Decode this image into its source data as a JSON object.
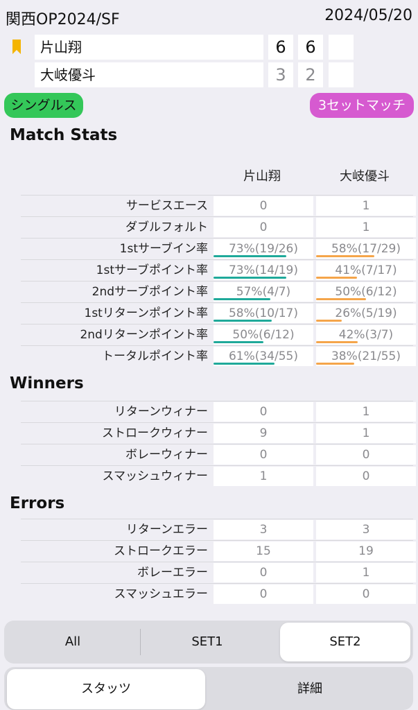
{
  "header": {
    "title": "関西OP2024/SF",
    "date": "2024/05/20"
  },
  "players": [
    {
      "name": "片山翔",
      "sets": [
        "6",
        "6",
        ""
      ]
    },
    {
      "name": "大岐優斗",
      "sets": [
        "3",
        "2",
        ""
      ]
    }
  ],
  "tags": {
    "format": "シングルス",
    "match_type": "3セットマッチ"
  },
  "colors": {
    "green_pill": "#34c759",
    "purple_pill": "#d65ad0",
    "player1_bar": "#1fa99a",
    "player2_bar": "#f5a54a",
    "bookmark": "#f4b400"
  },
  "sections": {
    "match_stats": {
      "title": "Match Stats",
      "col1": "片山翔",
      "col2": "大岐優斗",
      "rows": [
        {
          "label": "サービスエース",
          "p1": "0",
          "p2": "1"
        },
        {
          "label": "ダブルフォルト",
          "p1": "0",
          "p2": "1"
        },
        {
          "label": "1stサーブイン率",
          "p1": "73%(19/26)",
          "p2": "58%(17/29)",
          "p1_pct": 73,
          "p2_pct": 58
        },
        {
          "label": "1stサーブポイント率",
          "p1": "73%(14/19)",
          "p2": "41%(7/17)",
          "p1_pct": 73,
          "p2_pct": 41
        },
        {
          "label": "2ndサーブポイント率",
          "p1": "57%(4/7)",
          "p2": "50%(6/12)",
          "p1_pct": 57,
          "p2_pct": 50
        },
        {
          "label": "1stリターンポイント率",
          "p1": "58%(10/17)",
          "p2": "26%(5/19)",
          "p1_pct": 58,
          "p2_pct": 26
        },
        {
          "label": "2ndリターンポイント率",
          "p1": "50%(6/12)",
          "p2": "42%(3/7)",
          "p1_pct": 50,
          "p2_pct": 42
        },
        {
          "label": "トータルポイント率",
          "p1": "61%(34/55)",
          "p2": "38%(21/55)",
          "p1_pct": 61,
          "p2_pct": 38
        }
      ]
    },
    "winners": {
      "title": "Winners",
      "rows": [
        {
          "label": "リターンウィナー",
          "p1": "0",
          "p2": "1"
        },
        {
          "label": "ストロークウィナー",
          "p1": "9",
          "p2": "1"
        },
        {
          "label": "ボレーウィナー",
          "p1": "0",
          "p2": "0"
        },
        {
          "label": "スマッシュウィナー",
          "p1": "1",
          "p2": "0"
        }
      ]
    },
    "errors": {
      "title": "Errors",
      "rows": [
        {
          "label": "リターンエラー",
          "p1": "3",
          "p2": "3"
        },
        {
          "label": "ストロークエラー",
          "p1": "15",
          "p2": "19"
        },
        {
          "label": "ボレーエラー",
          "p1": "0",
          "p2": "1"
        },
        {
          "label": "スマッシュエラー",
          "p1": "0",
          "p2": "0"
        }
      ]
    }
  },
  "set_filter": {
    "options": [
      "All",
      "SET1",
      "SET2"
    ],
    "selected": "SET2"
  },
  "bottom_tabs": {
    "options": [
      "スタッツ",
      "詳細"
    ],
    "selected": "スタッツ"
  }
}
